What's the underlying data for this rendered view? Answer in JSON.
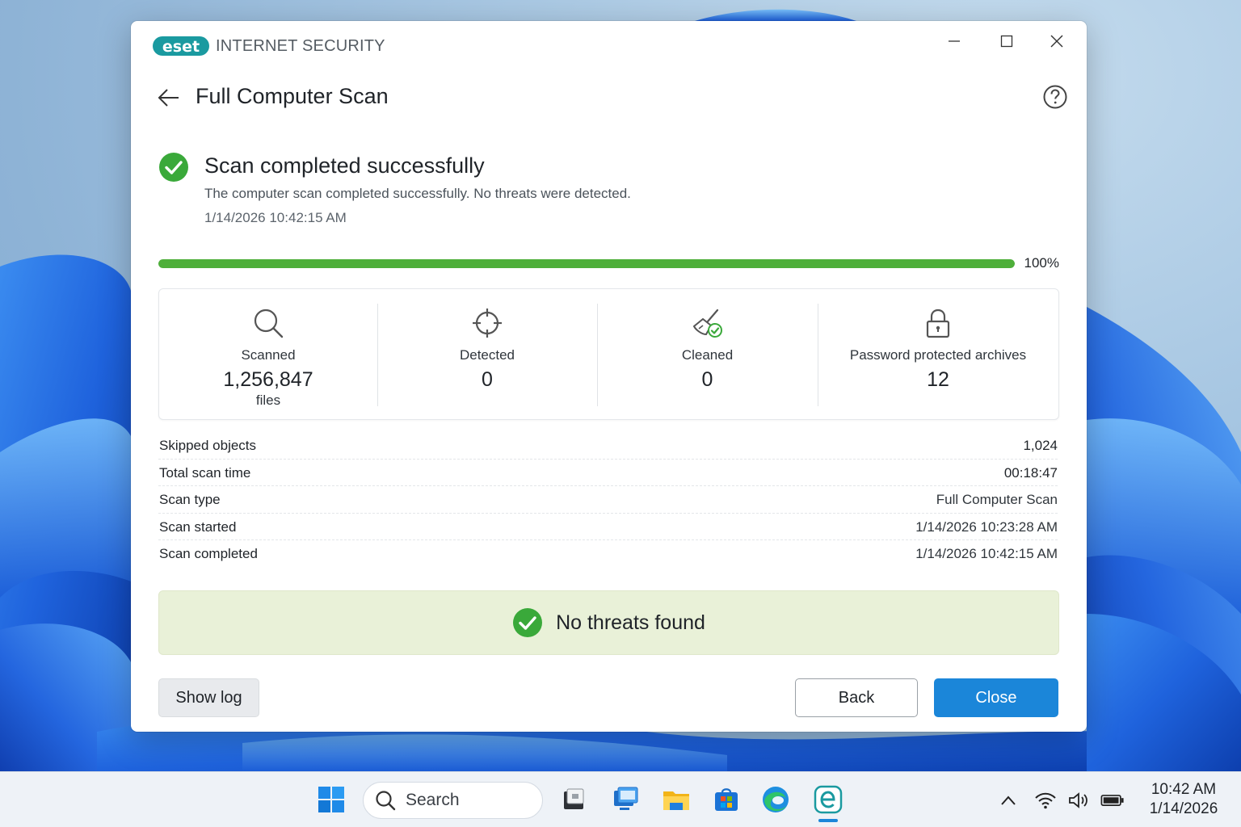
{
  "window": {
    "brand": "eset",
    "product_name": "INTERNET SECURITY",
    "page_title": "Full Computer Scan"
  },
  "status": {
    "title": "Scan completed successfully",
    "description": "The computer scan completed successfully. No threats were detected.",
    "timestamp": "1/14/2026 10:42:15 AM",
    "icon": "check-circle-icon"
  },
  "progress": {
    "value": 100,
    "label": "100%",
    "color": "#4eaf3a"
  },
  "stats": [
    {
      "icon": "search-icon",
      "label": "Scanned",
      "value": "1,256,847",
      "unit": "files"
    },
    {
      "icon": "crosshair-icon",
      "label": "Detected",
      "value": "0",
      "unit": ""
    },
    {
      "icon": "broom-check-icon",
      "label": "Cleaned",
      "value": "0",
      "unit": ""
    },
    {
      "icon": "lock-icon",
      "label": "Password protected archives",
      "value": "12",
      "unit": ""
    }
  ],
  "details": [
    {
      "label": "Skipped objects",
      "value": "1,024"
    },
    {
      "label": "Total scan time",
      "value": "00:18:47"
    },
    {
      "label": "Scan type",
      "value": "Full Computer Scan"
    },
    {
      "label": "Scan started",
      "value": "1/14/2026 10:23:28 AM"
    },
    {
      "label": "Scan completed",
      "value": "1/14/2026 10:42:15 AM"
    }
  ],
  "banner": {
    "text": "No threats found",
    "background": "#e9f1d8"
  },
  "buttons": {
    "show_log": "Show log",
    "back": "Back",
    "close": "Close"
  },
  "colors": {
    "accent": "#1b86d9",
    "success": "#4eaf3a",
    "eset_teal": "#1a9aa0"
  },
  "taskbar": {
    "search_label": "Search",
    "apps": [
      "start-icon",
      "app-icon",
      "remote-desktop-icon",
      "file-explorer-icon",
      "microsoft-store-icon",
      "edge-icon",
      "eset-app-icon"
    ],
    "tray": [
      "chevron-up-icon",
      "wifi-icon",
      "volume-icon",
      "battery-icon"
    ],
    "time": "10:42 AM",
    "date": "1/14/2026"
  }
}
